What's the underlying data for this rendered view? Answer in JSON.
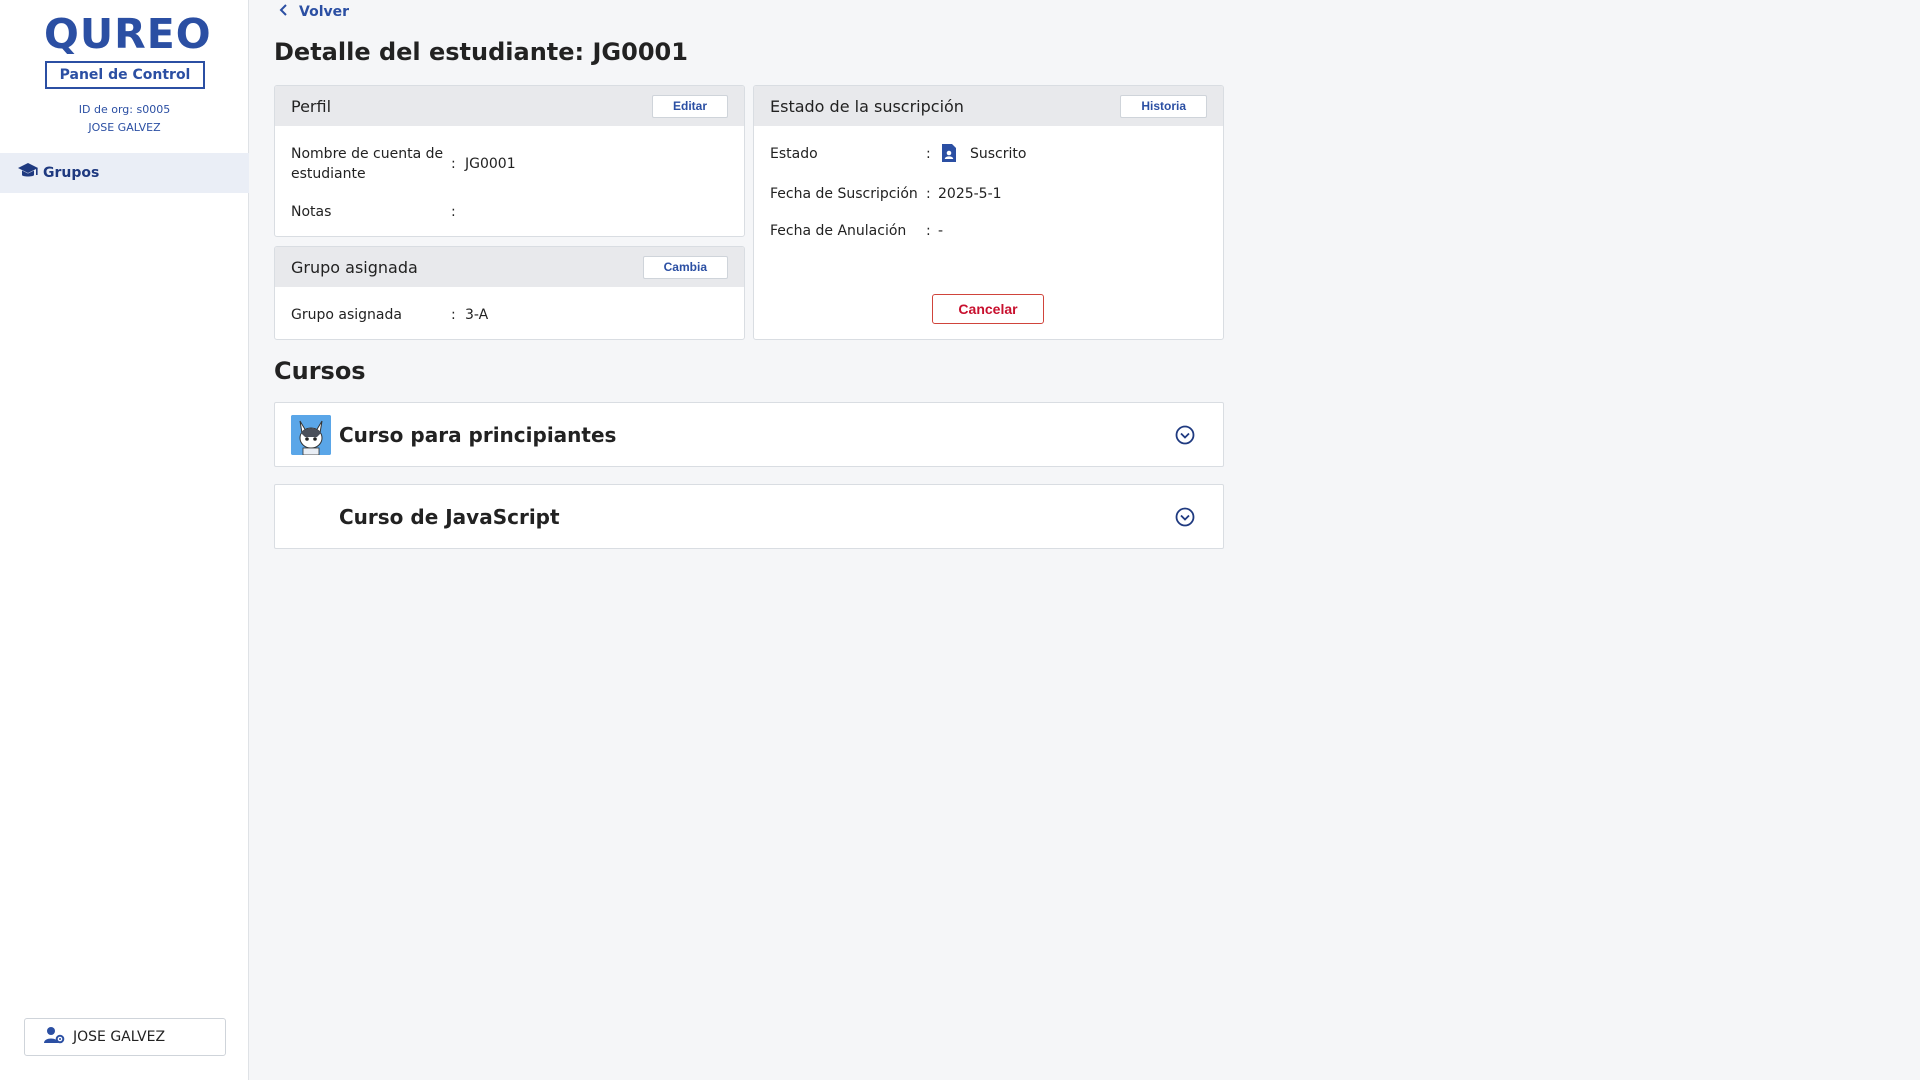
{
  "sidebar": {
    "logo_text": "QUREO",
    "panel_label": "Panel de Control",
    "org_id": "ID de org: s0005",
    "org_user": "JOSE GALVEZ",
    "nav": [
      {
        "label": "Grupos",
        "icon": "graduation-cap-icon"
      }
    ],
    "user_button_label": "JOSE GALVEZ"
  },
  "header": {
    "back_label": "Volver",
    "title": "Detalle del estudiante: JG0001"
  },
  "profile_card": {
    "title": "Perfil",
    "button": "Editar",
    "fields": [
      {
        "label": "Nombre de cuenta de estudiante",
        "value": "JG0001"
      },
      {
        "label": "Notas",
        "value": ""
      }
    ]
  },
  "group_card": {
    "title": "Grupo asignada",
    "button": "Cambia",
    "fields": [
      {
        "label": "Grupo asignada",
        "value": "3-A"
      }
    ]
  },
  "subscription_card": {
    "title": "Estado de la suscripción",
    "button": "Historia",
    "fields": [
      {
        "label": "Estado",
        "value": "Suscrito"
      },
      {
        "label": "Fecha de Suscripción",
        "value": "2025-5-1"
      },
      {
        "label": "Fecha de Anulación",
        "value": "-"
      }
    ],
    "cancel_button": "Cancelar"
  },
  "courses": {
    "title": "Cursos",
    "items": [
      {
        "title": "Curso para principiantes",
        "has_thumbnail": true
      },
      {
        "title": "Curso de JavaScript",
        "has_thumbnail": false
      }
    ]
  },
  "colors": {
    "brand": "#2b4fa3",
    "danger": "#c8102e",
    "background": "#f5f6f8"
  }
}
